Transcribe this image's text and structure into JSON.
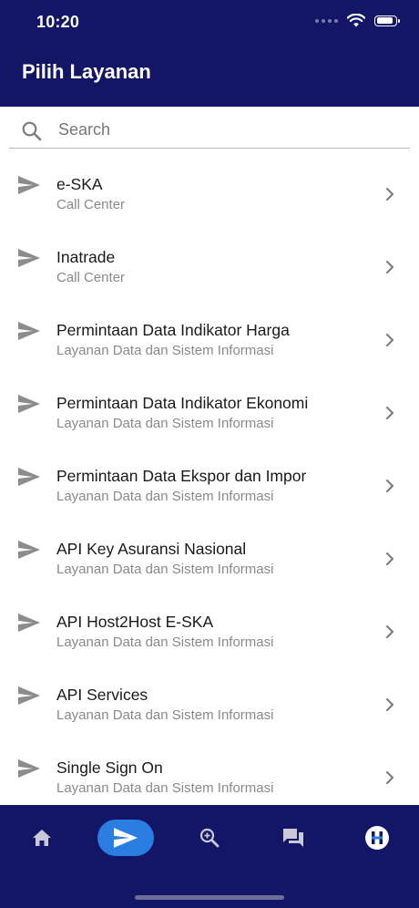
{
  "status": {
    "time": "10:20"
  },
  "header": {
    "title": "Pilih Layanan"
  },
  "search": {
    "placeholder": "Search"
  },
  "services": [
    {
      "title": "e-SKA",
      "subtitle": "Call Center"
    },
    {
      "title": "Inatrade",
      "subtitle": "Call Center"
    },
    {
      "title": "Permintaan Data Indikator Harga",
      "subtitle": "Layanan Data dan Sistem Informasi"
    },
    {
      "title": "Permintaan Data Indikator Ekonomi",
      "subtitle": "Layanan Data dan Sistem Informasi"
    },
    {
      "title": "Permintaan Data Ekspor dan Impor",
      "subtitle": "Layanan Data dan Sistem Informasi"
    },
    {
      "title": "API Key Asuransi Nasional",
      "subtitle": "Layanan Data dan Sistem Informasi"
    },
    {
      "title": "API Host2Host E-SKA",
      "subtitle": "Layanan Data dan Sistem Informasi"
    },
    {
      "title": "API Services",
      "subtitle": "Layanan Data dan Sistem Informasi"
    },
    {
      "title": "Single Sign On",
      "subtitle": "Layanan Data dan Sistem Informasi"
    }
  ],
  "bottom_nav": {
    "items": [
      "home-icon",
      "send-icon",
      "search-zoom-icon",
      "chat-icon",
      "profile-logo-icon"
    ],
    "active": "send-icon"
  },
  "colors": {
    "header": "#131567",
    "active": "#2a7de1",
    "icon": "#8c8c8c"
  }
}
